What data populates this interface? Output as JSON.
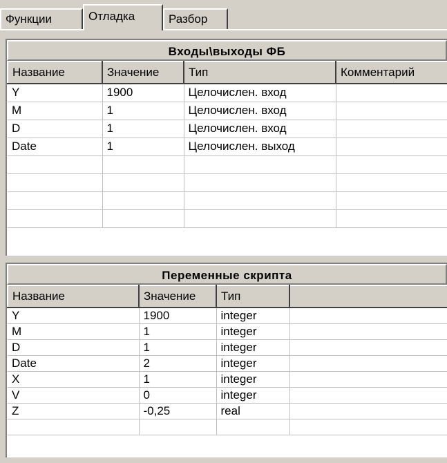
{
  "tabs": [
    {
      "label": "Функции",
      "active": false
    },
    {
      "label": "Отладка",
      "active": true
    },
    {
      "label": "Разбор",
      "active": false
    }
  ],
  "io_panel": {
    "title": "Входы\\выходы ФБ",
    "columns": [
      "Название",
      "Значение",
      "Тип",
      "Комментарий"
    ],
    "rows": [
      [
        "Y",
        "1900",
        "Целочислен. вход",
        ""
      ],
      [
        "M",
        "1",
        "Целочислен. вход",
        ""
      ],
      [
        "D",
        "1",
        "Целочислен. вход",
        ""
      ],
      [
        "Date",
        "1",
        "Целочислен. выход",
        ""
      ],
      [
        "",
        "",
        "",
        ""
      ],
      [
        "",
        "",
        "",
        ""
      ],
      [
        "",
        "",
        "",
        ""
      ],
      [
        "",
        "",
        "",
        ""
      ]
    ]
  },
  "vars_panel": {
    "title": "Переменные скрипта",
    "columns": [
      "Название",
      "Значение",
      "Тип",
      ""
    ],
    "rows": [
      [
        "Y",
        "1900",
        "integer",
        ""
      ],
      [
        "M",
        "1",
        "integer",
        ""
      ],
      [
        "D",
        "1",
        "integer",
        ""
      ],
      [
        "Date",
        "2",
        "integer",
        ""
      ],
      [
        "X",
        "1",
        "integer",
        ""
      ],
      [
        "V",
        "0",
        "integer",
        ""
      ],
      [
        "Z",
        "-0,25",
        "real",
        ""
      ],
      [
        "",
        "",
        "",
        ""
      ]
    ]
  }
}
